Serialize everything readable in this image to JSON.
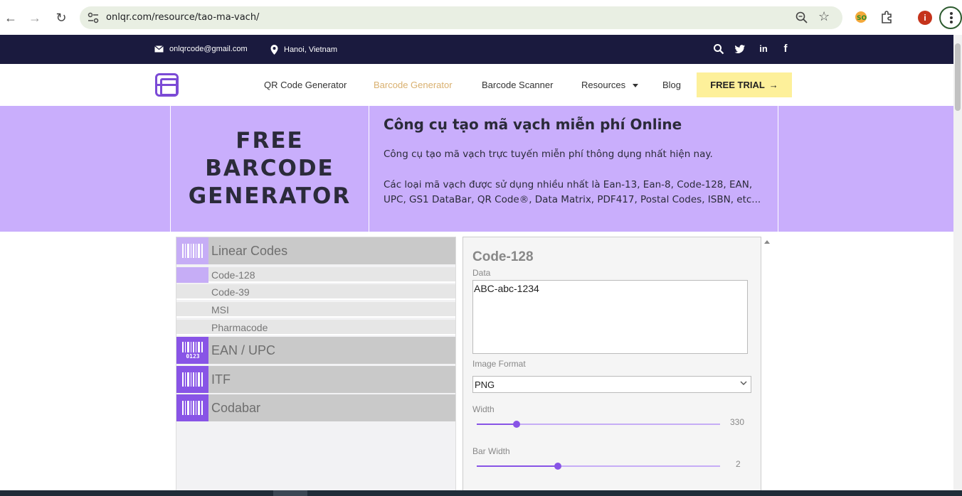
{
  "browser": {
    "url": "onlqr.com/resource/tao-ma-vach/",
    "profile_initial": "i"
  },
  "topbar": {
    "email": "onlqrcode@gmail.com",
    "location": "Hanoi, Vietnam"
  },
  "nav": {
    "items": [
      "QR Code Generator",
      "Barcode Generator",
      "Barcode Scanner",
      "Resources",
      "Blog"
    ],
    "active": "Barcode Generator",
    "cta": "FREE TRIAL"
  },
  "hero": {
    "title_lines": [
      "FREE",
      "BARCODE",
      "GENERATOR"
    ],
    "heading": "Công cụ tạo mã vạch miễn phí Online",
    "paragraph1": "Công cụ tạo mã vạch trực tuyến miễn phí thông dụng nhất hiện nay.",
    "paragraph2": "Các loại mã vạch được sử dụng nhiều nhất là Ean-13, Ean-8, Code-128, EAN, UPC, GS1 DataBar, QR Code®, Data Matrix, PDF417, Postal Codes, ISBN, etc..."
  },
  "categories": [
    {
      "label": "Linear Codes",
      "subitems": [
        "Code-128",
        "Code-39",
        "MSI",
        "Pharmacode"
      ],
      "active_subitem": "Code-128"
    },
    {
      "label": "EAN / UPC",
      "icon_text": "0123"
    },
    {
      "label": "ITF"
    },
    {
      "label": "Codabar"
    }
  ],
  "form": {
    "title": "Code-128",
    "data_label": "Data",
    "data_value": "ABC-abc-1234",
    "image_format_label": "Image Format",
    "image_format_value": "PNG",
    "width_label": "Width",
    "width_value": "330",
    "width_fraction": 0.165,
    "bar_width_label": "Bar Width",
    "bar_width_value": "2",
    "bar_width_fraction": 0.333
  },
  "colors": {
    "accent": "#8854e6",
    "hero_bg": "#c9aefc",
    "topbar_bg": "#1a1a3e",
    "cta_bg": "#fdf09a"
  }
}
